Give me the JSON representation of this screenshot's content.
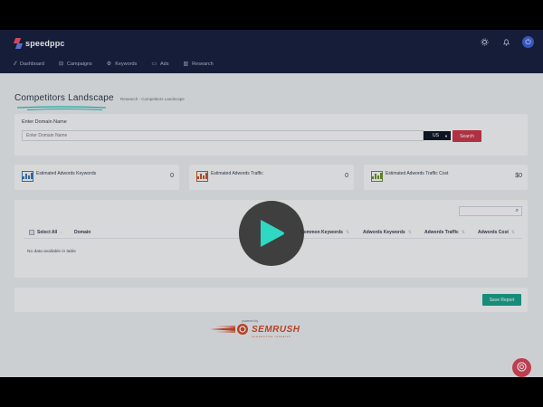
{
  "app": {
    "logo": "speedppc"
  },
  "nav": [
    {
      "icon": "dashboard-icon",
      "label": "Dashboard"
    },
    {
      "icon": "campaigns-icon",
      "label": "Campaigns"
    },
    {
      "icon": "keywords-icon",
      "label": "Keywords"
    },
    {
      "icon": "ads-icon",
      "label": "Ads"
    },
    {
      "icon": "research-icon",
      "label": "Research"
    }
  ],
  "page": {
    "title": "Competitors Landscape",
    "breadcrumb": "Research  -  Competitors Landscape"
  },
  "domain_form": {
    "label": "Enter Domain Name",
    "placeholder": "Enter Domain Name",
    "country": "US",
    "search_label": "Search"
  },
  "stats": [
    {
      "label": "Estimated Adwords Keywords",
      "value": "0",
      "color": "#3a78b8"
    },
    {
      "label": "Estimated Adwords Traffic",
      "value": "0",
      "color": "#c4582f"
    },
    {
      "label": "Estimated Adwords Traffic Cost",
      "value": "$0",
      "color": "#6e8f2e"
    }
  ],
  "table": {
    "columns": [
      "Select All",
      "Domain",
      "Common Keywords",
      "Adwords Keywords",
      "Adwords Traffic",
      "Adwords Cost"
    ],
    "empty_text": "No data available in table"
  },
  "report": {
    "button_label": "Save Report"
  },
  "footer": {
    "powered_by": "powered by",
    "brand": "SEMRUSH",
    "brand_sub": "competitive research"
  },
  "colors": {
    "topbar": "#1a2140",
    "accent_red": "#c8384e",
    "accent_teal": "#1aa08a",
    "play_accent": "#2ed8c3"
  }
}
